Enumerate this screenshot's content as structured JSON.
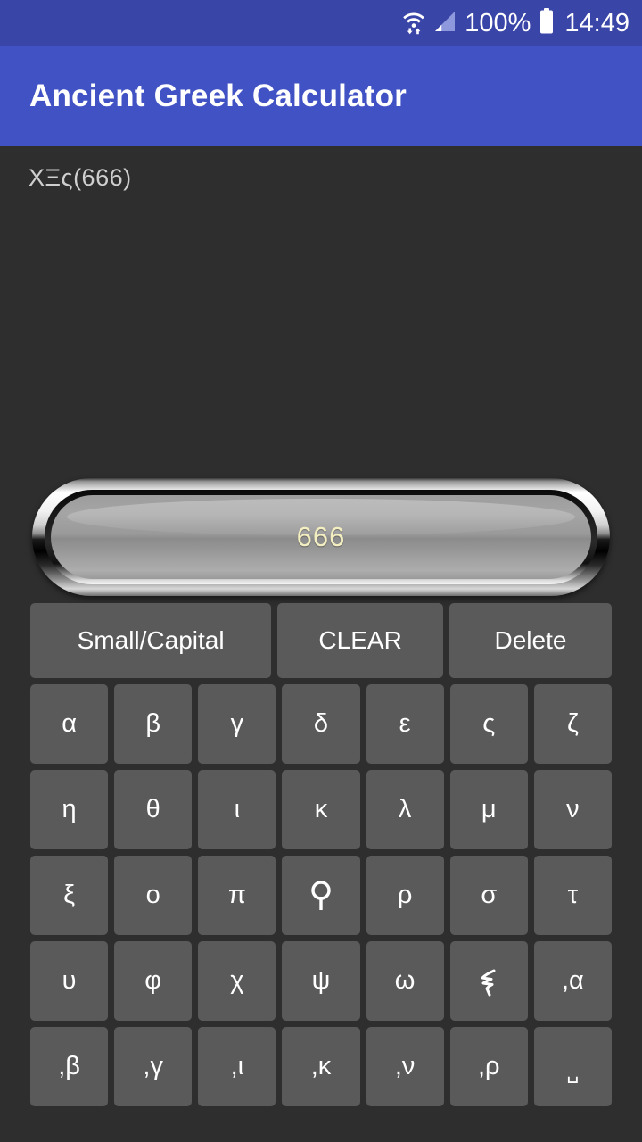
{
  "status_bar": {
    "background": "#3a45a8",
    "wifi_icon": "wifi-with-transfer-arrows-icon",
    "signal_icon": "cellular-signal-icon",
    "battery_percent": "100%",
    "battery_icon": "battery-full-icon",
    "clock": "14:49"
  },
  "app_bar": {
    "background": "#4152c4",
    "title": "Ancient Greek Calculator"
  },
  "display": {
    "expression": "ΧΞς(666)",
    "value": "666",
    "value_color": "#f4efc0"
  },
  "keypad": {
    "background": "#2e2e2e",
    "key_color": "#5a5a5a",
    "key_text_color": "#ffffff",
    "actions": [
      {
        "label": "Small/Capital",
        "name": "small-capital-button"
      },
      {
        "label": "CLEAR",
        "name": "clear-button"
      },
      {
        "label": "Delete",
        "name": "delete-button"
      }
    ],
    "rows": [
      [
        {
          "label": "α"
        },
        {
          "label": "β"
        },
        {
          "label": "γ"
        },
        {
          "label": "δ"
        },
        {
          "label": "ε"
        },
        {
          "label": "ς"
        },
        {
          "label": "ζ"
        }
      ],
      [
        {
          "label": "η"
        },
        {
          "label": "θ"
        },
        {
          "label": "ι"
        },
        {
          "label": "κ"
        },
        {
          "label": "λ"
        },
        {
          "label": "μ"
        },
        {
          "label": "ν"
        }
      ],
      [
        {
          "label": "ξ"
        },
        {
          "label": "ο"
        },
        {
          "label": "π"
        },
        {
          "label": "ϙ"
        },
        {
          "label": "ρ"
        },
        {
          "label": "σ"
        },
        {
          "label": "τ"
        }
      ],
      [
        {
          "label": "υ"
        },
        {
          "label": "φ"
        },
        {
          "label": "χ"
        },
        {
          "label": "ψ"
        },
        {
          "label": "ω"
        },
        {
          "label": "ϡ"
        },
        {
          "label": ",α"
        }
      ],
      [
        {
          "label": ",β"
        },
        {
          "label": ",γ"
        },
        {
          "label": ",ι"
        },
        {
          "label": ",κ"
        },
        {
          "label": ",ν"
        },
        {
          "label": ",ρ"
        },
        {
          "label": "␣"
        }
      ]
    ]
  }
}
